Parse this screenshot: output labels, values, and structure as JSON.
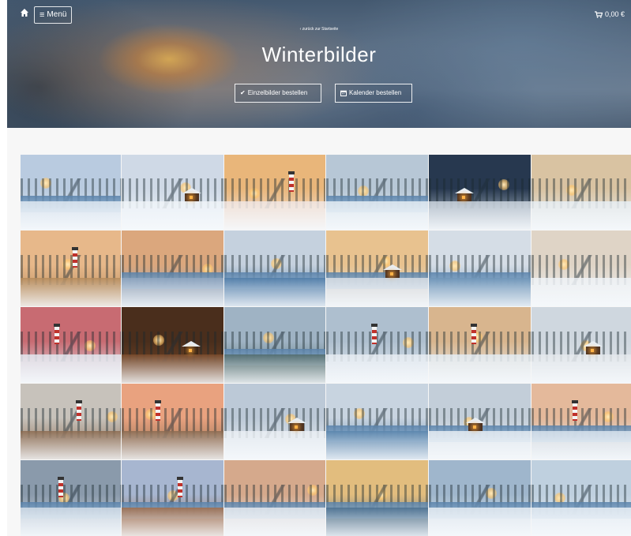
{
  "header": {
    "menu_label": "Menü",
    "cart_total": "0,00 €",
    "back_link": "‹ zurück zur Startseite",
    "title": "Winterbilder"
  },
  "actions": {
    "order_single_label": "Einzelbilder bestellen",
    "order_calendar_label": "Kalender bestellen"
  },
  "gallery": {
    "tiles": [
      {
        "scene": "snowy-forest-river",
        "sky": "#b9cbe0",
        "ground": "#dfe8f1",
        "accent": "#2f4a52"
      },
      {
        "scene": "snowy-branches-cabin",
        "sky": "#cfd9e6",
        "ground": "#eef3f8",
        "accent": "#5a3b26"
      },
      {
        "scene": "lighthouse-sunset-snow",
        "sky": "#e9b67a",
        "ground": "#f1e6e2",
        "accent": "#3c5f85"
      },
      {
        "scene": "snowy-bay-rocks",
        "sky": "#b7c7d6",
        "ground": "#e5edf3",
        "accent": "#6d7f8f"
      },
      {
        "scene": "village-street-night",
        "sky": "#27384f",
        "ground": "#c9d3dd",
        "accent": "#f0a040"
      },
      {
        "scene": "mountain-forest-sunrise",
        "sky": "#d9c3a2",
        "ground": "#e7eef3",
        "accent": "#2e3f3c"
      },
      {
        "scene": "lighthouse-rocky-coast",
        "sky": "#e7b88a",
        "ground": "#b58a5a",
        "accent": "#2d4b66"
      },
      {
        "scene": "lake-sunset-forest",
        "sky": "#dba77d",
        "ground": "#8fa5bf",
        "accent": "#3b3f4a"
      },
      {
        "scene": "winter-lake-sunburst",
        "sky": "#c5d1de",
        "ground": "#4f7ca8",
        "accent": "#2c3e32"
      },
      {
        "scene": "forest-cabin-lake",
        "sky": "#e8c28f",
        "ground": "#d7dde4",
        "accent": "#5b3b22"
      },
      {
        "scene": "frozen-lake-trees",
        "sky": "#d5dde6",
        "ground": "#6f95b8",
        "accent": "#3d5660"
      },
      {
        "scene": "snowy-mountain-valley",
        "sky": "#dfd4c6",
        "ground": "#eef2f6",
        "accent": "#8d9aa8"
      },
      {
        "scene": "lighthouse-pink-sky",
        "sky": "#c86b72",
        "ground": "#e2e6ee",
        "accent": "#2e3f55"
      },
      {
        "scene": "cozy-fireplace-interior",
        "sky": "#4a2e1c",
        "ground": "#7a4a2a",
        "accent": "#ff9a3c"
      },
      {
        "scene": "forest-lake-mirror",
        "sky": "#9fb3c4",
        "ground": "#506a6a",
        "accent": "#2c4238"
      },
      {
        "scene": "lighthouse-snowy-rocks",
        "sky": "#aebfcf",
        "ground": "#e6ecf2",
        "accent": "#4a5a6a"
      },
      {
        "scene": "lighthouse-red-white-coast",
        "sky": "#d8b58e",
        "ground": "#e4ecf2",
        "accent": "#b23a31"
      },
      {
        "scene": "cabin-autumn-snow",
        "sky": "#cfd7df",
        "ground": "#e4e8ec",
        "accent": "#6b3a22"
      },
      {
        "scene": "lighthouse-cloudy-cliff",
        "sky": "#c7c2bb",
        "ground": "#8b6a4f",
        "accent": "#b23a31"
      },
      {
        "scene": "lighthouse-path-sunset",
        "sky": "#e9a27f",
        "ground": "#8a6a50",
        "accent": "#e9e2dc"
      },
      {
        "scene": "snowy-forest-cabin-glow",
        "sky": "#bcc9d7",
        "ground": "#e9eef3",
        "accent": "#d9772f"
      },
      {
        "scene": "frosted-trees-river",
        "sky": "#c8d4e0",
        "ground": "#5a85ad",
        "accent": "#4a5f70"
      },
      {
        "scene": "snowy-branches-cabin-lake",
        "sky": "#c3ced9",
        "ground": "#e6ecf2",
        "accent": "#7a4a30"
      },
      {
        "scene": "boats-lighthouse-harbor",
        "sky": "#e4b99b",
        "ground": "#d8e2ec",
        "accent": "#a8452f"
      },
      {
        "scene": "lighthouse-stormy-sea",
        "sky": "#8a9aab",
        "ground": "#d3dde7",
        "accent": "#3f4f5f"
      },
      {
        "scene": "lighthouse-dusk-shore",
        "sky": "#a7b6d0",
        "ground": "#a06b48",
        "accent": "#f2f0ee"
      },
      {
        "scene": "mountain-lake-autumn",
        "sky": "#d5a98c",
        "ground": "#e5e9ee",
        "accent": "#a8562f"
      },
      {
        "scene": "golden-trees-lake",
        "sky": "#e2bd7e",
        "ground": "#4a6f8f",
        "accent": "#3b3428"
      },
      {
        "scene": "frozen-river-sunset",
        "sky": "#9fb6cc",
        "ground": "#e7edf3",
        "accent": "#e8a041"
      },
      {
        "scene": "icicles-frozen-water",
        "sky": "#bfd0df",
        "ground": "#e9eff5",
        "accent": "#6f8aa3"
      }
    ]
  }
}
